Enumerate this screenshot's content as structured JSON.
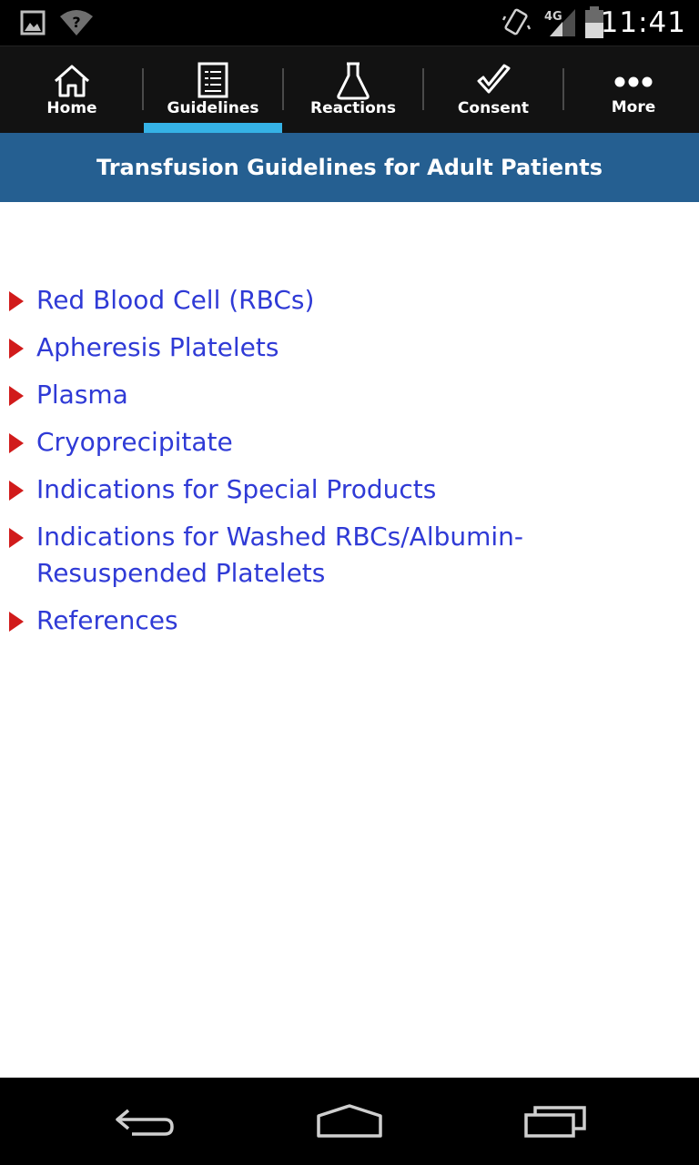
{
  "status_bar": {
    "time": "11:41",
    "network": "4G",
    "icons": [
      "image-notification-icon",
      "wifi-unknown-icon",
      "vibrate-icon",
      "signal-icon",
      "battery-icon"
    ]
  },
  "tabs": [
    {
      "label": "Home",
      "icon": "home-icon",
      "selected": false
    },
    {
      "label": "Guidelines",
      "icon": "guidelines-icon",
      "selected": true
    },
    {
      "label": "Reactions",
      "icon": "flask-icon",
      "selected": false
    },
    {
      "label": "Consent",
      "icon": "checkmark-icon",
      "selected": false
    },
    {
      "label": "More",
      "icon": "more-dots-icon",
      "selected": false
    }
  ],
  "header": {
    "title": "Transfusion Guidelines for Adult Patients"
  },
  "guidelines": [
    {
      "label": "Red Blood Cell (RBCs)"
    },
    {
      "label": "Apheresis Platelets"
    },
    {
      "label": "Plasma"
    },
    {
      "label": "Cryoprecipitate"
    },
    {
      "label": "Indications for Special Products"
    },
    {
      "label": "Indications for Washed RBCs/Albumin-Resuspended Platelets"
    },
    {
      "label": "References"
    }
  ],
  "nav_bar": {
    "buttons": [
      "back-icon",
      "home-nav-icon",
      "recent-apps-icon"
    ]
  },
  "colors": {
    "header_bg": "#255f91",
    "tab_indicator": "#35b2e6",
    "link": "#2f3ad6",
    "bullet": "#d11b1b"
  }
}
